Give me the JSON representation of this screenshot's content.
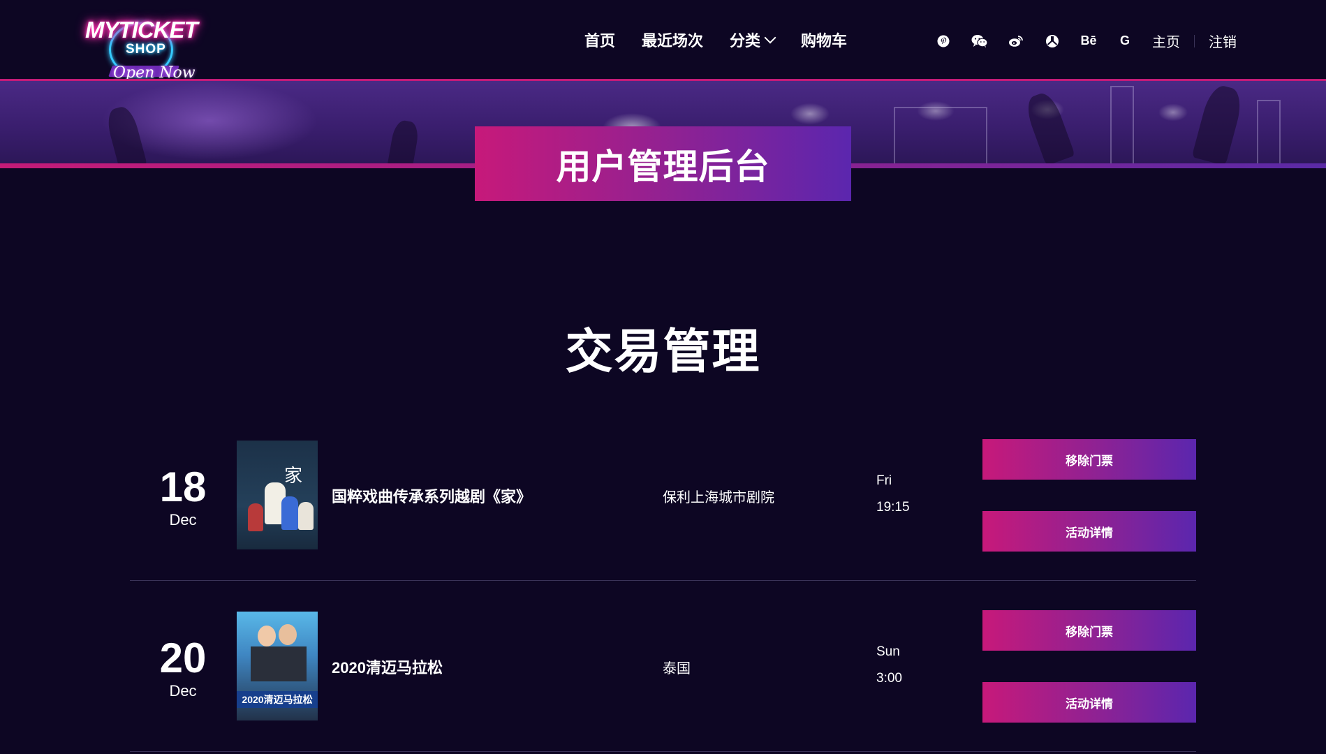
{
  "header": {
    "logo": {
      "brand": "MYTICKET",
      "sub": "SHOP",
      "tagline": "Open Now"
    },
    "nav": [
      {
        "label": "首页"
      },
      {
        "label": "最近场次"
      },
      {
        "label": "分类",
        "has_dropdown": true
      },
      {
        "label": "购物车"
      }
    ],
    "social_icons": [
      "pinterest-icon",
      "wechat-icon",
      "weibo-icon",
      "renren-icon",
      "behance-icon",
      "google-icon"
    ],
    "behance_text": "Bē",
    "google_text": "G",
    "links": {
      "home": "主页",
      "logout": "注销"
    }
  },
  "banner": {
    "title": "用户管理后台"
  },
  "section": {
    "title": "交易管理"
  },
  "colors": {
    "background": "#0d0623",
    "accent_start": "#c7197a",
    "accent_end": "#5b26ae",
    "divider": "#3a3358"
  },
  "events": [
    {
      "day": "18",
      "month": "Dec",
      "name": "国粹戏曲传承系列越剧《家》",
      "venue": "保利上海城市剧院",
      "weekday": "Fri",
      "time": "19:15",
      "thumb_text": "家",
      "remove_label": "移除门票",
      "detail_label": "活动详情"
    },
    {
      "day": "20",
      "month": "Dec",
      "name": "2020清迈马拉松",
      "venue": "泰国",
      "weekday": "Sun",
      "time": "3:00",
      "thumb_text": "2020清迈马拉松",
      "remove_label": "移除门票",
      "detail_label": "活动详情"
    }
  ]
}
